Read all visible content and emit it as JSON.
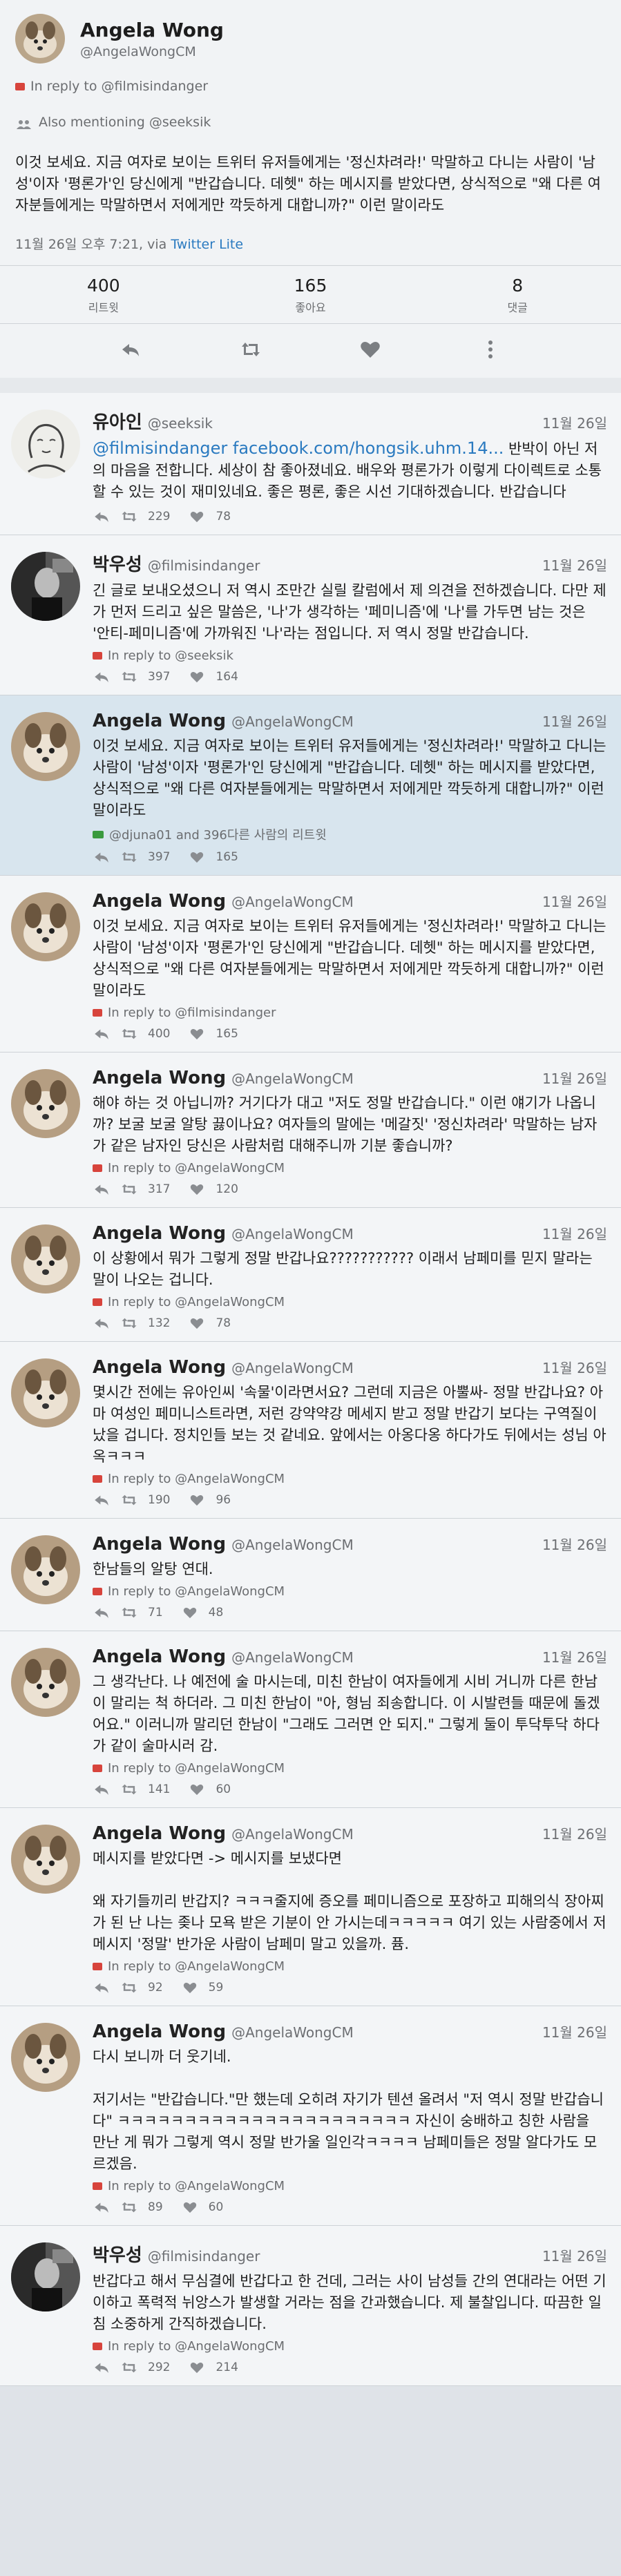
{
  "main_tweet": {
    "name": "Angela Wong",
    "handle": "@AngelaWongCM",
    "in_reply_to": "In reply to @filmisindanger",
    "also_mentioning": "Also mentioning @seeksik",
    "text": "이것 보세요. 지금 여자로 보이는 트위터 유저들에게는 '정신차려라!' 막말하고 다니는 사람이 '남성'이자 '평론가'인 당신에게 \"반갑습니다. 데헷\" 하는 메시지를 받았다면, 상식적으로 \"왜 다른 여자분들에게는 막말하면서 저에게만 깍듯하게 대합니까?\" 이런 말이라도",
    "time": "11월 26일 오후 7:21, via ",
    "via": "Twitter Lite",
    "stats": [
      {
        "num": "400",
        "label": "리트윗"
      },
      {
        "num": "165",
        "label": "좋아요"
      },
      {
        "num": "8",
        "label": "댓글"
      }
    ],
    "actions": [
      "reply-icon",
      "retweet-icon",
      "heart-icon",
      "more-icon"
    ]
  },
  "replies": [
    {
      "name": "유아인",
      "handle": "@seeksik",
      "date": "11월 26일",
      "link": "@filmisindanger facebook.com/hongsik.uhm.14...",
      "text": " 반박이 아닌 저의 마음을 전합니다. 세상이 참 좋아졌네요. 배우와 평론가가 이렇게 다이렉트로 소통 할 수 있는 것이 재미있네요. 좋은 평론, 좋은 시선 기대하겠습니다. 반갑습니다",
      "meta": "",
      "retweets": "229",
      "likes": "78",
      "highlight": false,
      "avatar": "sketch"
    },
    {
      "name": "박우성",
      "handle": "@filmisindanger",
      "date": "11월 26일",
      "link": "",
      "text": "긴 글로 보내오셨으니 저 역시 조만간 실릴 칼럼에서 제 의견을 전하겠습니다. 다만 제가 먼저 드리고 싶은 말씀은, '나'가 생각하는 '페미니즘'에 '나'를 가두면 남는 것은 '안티-페미니즘'에 가까워진 '나'라는 점입니다. 저 역시 정말 반갑습니다.",
      "meta": "In reply to @seeksik",
      "retweets": "397",
      "likes": "164",
      "highlight": false,
      "avatar": "bw"
    },
    {
      "name": "Angela Wong",
      "handle": "@AngelaWongCM",
      "date": "11월 26일",
      "link": "",
      "text": "이것 보세요. 지금 여자로 보이는 트위터 유저들에게는 '정신차려라!' 막말하고 다니는 사람이 '남성'이자 '평론가'인 당신에게 \"반갑습니다. 데헷\" 하는 메시지를 받았다면, 상식적으로 \"왜 다른 여자분들에게는 막말하면서 저에게만 깍듯하게 대합니까?\" 이런 말이라도",
      "meta": "@djuna01 and 396다른 사람의 리트윗",
      "meta_type": "rt",
      "retweets": "397",
      "likes": "165",
      "highlight": true,
      "avatar": "dog"
    },
    {
      "name": "Angela Wong",
      "handle": "@AngelaWongCM",
      "date": "11월 26일",
      "link": "",
      "text": "이것 보세요. 지금 여자로 보이는 트위터 유저들에게는 '정신차려라!' 막말하고 다니는 사람이 '남성'이자 '평론가'인 당신에게 \"반갑습니다. 데헷\" 하는 메시지를 받았다면, 상식적으로 \"왜 다른 여자분들에게는 막말하면서 저에게만 깍듯하게 대합니까?\" 이런 말이라도",
      "meta": "In reply to @filmisindanger",
      "retweets": "400",
      "likes": "165",
      "highlight": false,
      "avatar": "dog"
    },
    {
      "name": "Angela Wong",
      "handle": "@AngelaWongCM",
      "date": "11월 26일",
      "link": "",
      "text": "해야 하는 것 아닙니까? 거기다가 대고 \"저도 정말 반갑습니다.\" 이런 얘기가 나옵니까? 보굴 보굴 알탕 끓이나요? 여자들의 말에는 '메갈짓' '정신차려라' 막말하는 남자가 같은 남자인 당신은 사람처럼 대해주니까 기분 좋습니까?",
      "meta": "In reply to @AngelaWongCM",
      "retweets": "317",
      "likes": "120",
      "highlight": false,
      "avatar": "dog"
    },
    {
      "name": "Angela Wong",
      "handle": "@AngelaWongCM",
      "date": "11월 26일",
      "link": "",
      "text": "이 상황에서 뭐가 그렇게 정말 반갑나요??????????? 이래서 남페미를 믿지 말라는 말이 나오는 겁니다.",
      "meta": "In reply to @AngelaWongCM",
      "retweets": "132",
      "likes": "78",
      "highlight": false,
      "avatar": "dog"
    },
    {
      "name": "Angela Wong",
      "handle": "@AngelaWongCM",
      "date": "11월 26일",
      "link": "",
      "text": "몇시간 전에는 유아인씨 '속물'이라면서요? 그런데 지금은 아뿔싸- 정말 반갑나요? 아마 여성인 페미니스트라면, 저런 강약약강 메세지 받고 정말 반갑기 보다는 구역질이 났을 겁니다. 정치인들 보는 것 같네요. 앞에서는 아옹다옹 하다가도 뒤에서는 성님 아옥ㅋㅋㅋ",
      "meta": "In reply to @AngelaWongCM",
      "retweets": "190",
      "likes": "96",
      "highlight": false,
      "avatar": "dog"
    },
    {
      "name": "Angela Wong",
      "handle": "@AngelaWongCM",
      "date": "11월 26일",
      "link": "",
      "text": "한남들의 알탕 연대.",
      "meta": "In reply to @AngelaWongCM",
      "retweets": "71",
      "likes": "48",
      "highlight": false,
      "avatar": "dog"
    },
    {
      "name": "Angela Wong",
      "handle": "@AngelaWongCM",
      "date": "11월 26일",
      "link": "",
      "text": "그 생각난다. 나 예전에 술 마시는데, 미친 한남이 여자들에게 시비 거니까 다른 한남이 말리는 척 하더라. 그 미친 한남이 \"아, 형님 죄송합니다. 이 시발련들 때문에 돌겠어요.\" 이러니까 말리던 한남이 \"그래도 그러면 안 되지.\" 그렇게 둘이 투닥투닥 하다가 같이 술마시러 감.",
      "meta": "In reply to @AngelaWongCM",
      "retweets": "141",
      "likes": "60",
      "highlight": false,
      "avatar": "dog"
    },
    {
      "name": "Angela Wong",
      "handle": "@AngelaWongCM",
      "date": "11월 26일",
      "link": "",
      "text": "메시지를 받았다면 -> 메시지를 보냈다면\n\n왜 자기들끼리 반갑지? ㅋㅋㅋ줄지에 증오를 페미니즘으로 포장하고 피해의식 장아찌가 된 난 나는 좆나 모욕 받은 기분이 안 가시는데ㅋㅋㅋㅋㅋ 여기 있는 사람중에서 저 메시지 '정말' 반가운 사람이 남페미 말고 있을까. 퓸.",
      "meta": "In reply to @AngelaWongCM",
      "retweets": "92",
      "likes": "59",
      "highlight": false,
      "avatar": "dog"
    },
    {
      "name": "Angela Wong",
      "handle": "@AngelaWongCM",
      "date": "11월 26일",
      "link": "",
      "text": "다시 보니까 더 웃기네.\n\n저기서는 \"반갑습니다.\"만 했는데 오히려 자기가 텐션 올려서 \"저 역시 정말 반갑습니다\" ㅋㅋㅋㅋㅋㅋㅋㅋㅋㅋㅋㅋㅋㅋㅋㅋㅋㅋㅋㅋㅋㅋ 자신이 숭배하고 칭한 사람을 만난 게 뭐가 그렇게 역시 정말 반가울 일인각ㅋㅋㅋㅋ 남페미들은 정말 알다가도 모르겠음.",
      "meta": "In reply to @AngelaWongCM",
      "retweets": "89",
      "likes": "60",
      "highlight": false,
      "avatar": "dog"
    },
    {
      "name": "박우성",
      "handle": "@filmisindanger",
      "date": "11월 26일",
      "link": "",
      "text": "반갑다고 해서 무심결에 반갑다고 한 건데, 그러는 사이 남성들 간의 연대라는 어떤 기이하고 폭력적 뉘앙스가 발생할 거라는 점을 간과했습니다. 제 불찰입니다. 따끔한 일침 소중하게 간직하겠습니다.",
      "meta": "In reply to @AngelaWongCM",
      "retweets": "292",
      "likes": "214",
      "highlight": false,
      "avatar": "bw"
    }
  ]
}
